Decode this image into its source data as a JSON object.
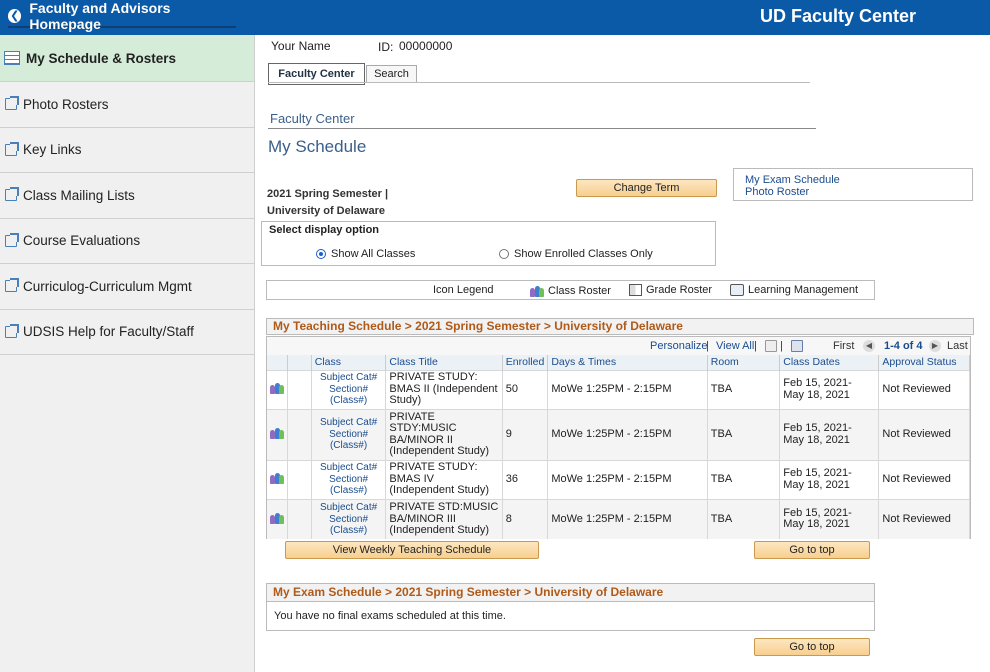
{
  "header": {
    "back_label": "Faculty and Advisors Homepage",
    "app_title": "UD Faculty Center"
  },
  "sidebar": {
    "items": [
      {
        "label": "My Schedule & Rosters",
        "icon": "grid-icon",
        "active": true
      },
      {
        "label": "Photo Rosters",
        "icon": "external-link-icon"
      },
      {
        "label": "Key Links",
        "icon": "external-link-icon"
      },
      {
        "label": "Class Mailing Lists",
        "icon": "external-link-icon"
      },
      {
        "label": "Course Evaluations",
        "icon": "external-link-icon"
      },
      {
        "label": "Curriculog-Curriculum Mgmt",
        "icon": "external-link-icon"
      },
      {
        "label": "UDSIS Help for Faculty/Staff",
        "icon": "external-link-icon"
      }
    ]
  },
  "user": {
    "name_label": "Your Name",
    "id_label": "ID:",
    "id_value": "00000000"
  },
  "tabs": [
    {
      "label": "Faculty Center",
      "active": true
    },
    {
      "label": "Search"
    }
  ],
  "breadcrumb": "Faculty Center",
  "page_title": "My Schedule",
  "term": {
    "line1": "2021 Spring Semester |",
    "line2": "University of Delaware",
    "change_term_label": "Change Term"
  },
  "quick_links": [
    "My Exam Schedule",
    "Photo Roster"
  ],
  "display_option": {
    "title": "Select display option",
    "show_all_label": "Show All Classes",
    "show_enrolled_label": "Show Enrolled Classes Only",
    "selected": "show_all"
  },
  "icon_legend": {
    "title": "Icon Legend",
    "class_roster": "Class Roster",
    "grade_roster": "Grade Roster",
    "learning_mgmt": "Learning Management"
  },
  "teaching_schedule": {
    "heading": "My Teaching Schedule > 2021 Spring Semester > University of Delaware",
    "personalize": "Personalize",
    "view_all": "View All",
    "first": "First",
    "range": "1-4 of 4",
    "last": "Last",
    "columns": [
      "Class",
      "Class Title",
      "Enrolled",
      "Days & Times",
      "Room",
      "Class Dates",
      "Approval Status"
    ],
    "rows": [
      {
        "class_line1": "Subject Cat#",
        "class_line2": "Section#",
        "class_line3": "(Class#)",
        "title": "PRIVATE STUDY: BMAS II (Independent Study)",
        "enrolled": "50",
        "days_times": "MoWe 1:25PM - 2:15PM",
        "room": "TBA",
        "dates": "Feb 15, 2021- May 18, 2021",
        "status": "Not Reviewed"
      },
      {
        "class_line1": "Subject Cat#",
        "class_line2": "Section#",
        "class_line3": "(Class#)",
        "title": "PRIVATE STDY:MUSIC BA/MINOR II (Independent Study)",
        "enrolled": "9",
        "days_times": "MoWe 1:25PM - 2:15PM",
        "room": "TBA",
        "dates": "Feb 15, 2021- May 18, 2021",
        "status": "Not Reviewed"
      },
      {
        "class_line1": "Subject Cat#",
        "class_line2": "Section#",
        "class_line3": "(Class#)",
        "title": "PRIVATE STUDY: BMAS IV (Independent Study)",
        "enrolled": "36",
        "days_times": "MoWe 1:25PM - 2:15PM",
        "room": "TBA",
        "dates": "Feb 15, 2021- May 18, 2021",
        "status": "Not Reviewed"
      },
      {
        "class_line1": "Subject Cat#",
        "class_line2": "Section#",
        "class_line3": "(Class#)",
        "title": "PRIVATE STD:MUSIC BA/MINOR III (Independent Study)",
        "enrolled": "8",
        "days_times": "MoWe 1:25PM - 2:15PM",
        "room": "TBA",
        "dates": "Feb 15, 2021- May 18, 2021",
        "status": "Not Reviewed"
      }
    ],
    "weekly_button": "View Weekly Teaching Schedule",
    "top_button": "Go to top"
  },
  "exam_schedule": {
    "heading": "My Exam Schedule > 2021 Spring Semester > University of Delaware",
    "message": "You have no final exams scheduled at this time.",
    "top_button": "Go to top"
  }
}
